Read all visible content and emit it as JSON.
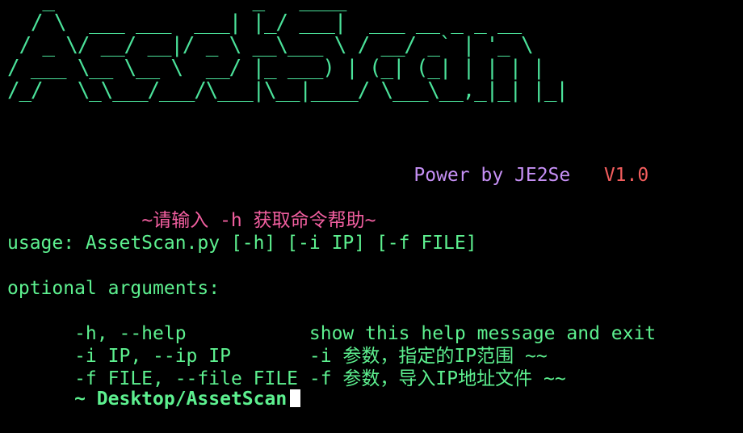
{
  "colors": {
    "background": "#000000",
    "banner": "#4be29a",
    "power_text": "#c690f5",
    "version": "#f25d5d",
    "hint": "#f25fa0",
    "terminal_text": "#5df08f",
    "cursor": "#ffffff"
  },
  "banner": {
    "ascii_lines": [
      "   _                 _   ____",
      "  / \\  ___ ___  ___| |_/ ___|  ___ __ _ _ __",
      " / _ \\/ __/ __|/ _ \\ __\\___ \\ / __/ _` | '_ \\",
      "/ ___ \\__ \\__ \\  __/ |_ ___) | (_| (_| | | | |",
      "/_/   \\_\\___/___/\\___|\\__|____/ \\___\\__,_|_| |_|"
    ]
  },
  "power": {
    "label": "Power by JE2Se",
    "version": "V1.0"
  },
  "hint": {
    "text": "~请输入 -h 获取命令帮助~"
  },
  "help": {
    "usage": "usage: AssetScan.py [-h] [-i IP] [-f FILE]",
    "section_title": "optional arguments:",
    "options": [
      {
        "flag": "  -h, --help           ",
        "description": "show this help message and exit"
      },
      {
        "flag": "  -i IP, --ip IP       ",
        "description": "-i 参数，指定的IP范围 ~~"
      },
      {
        "flag": "  -f FILE, --file FILE ",
        "description": "-f 参数，导入IP地址文件 ~~"
      }
    ]
  },
  "prompt": {
    "text": "  ~ Desktop/AssetScan"
  }
}
